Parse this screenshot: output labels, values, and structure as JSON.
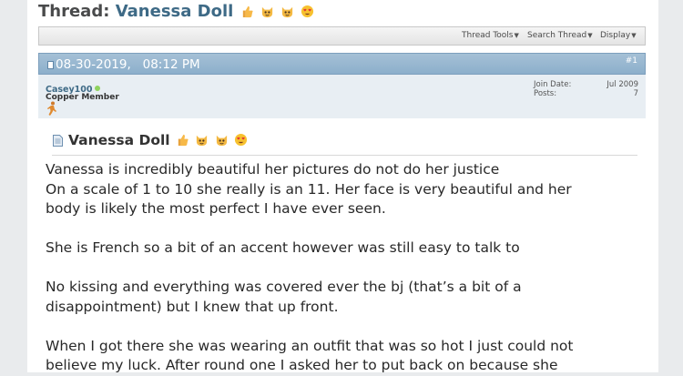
{
  "thread": {
    "prefix": "Thread:",
    "name": "Vanessa Doll",
    "emojis": [
      "thumbs-up-icon",
      "cat-face-icon",
      "cat-face-icon",
      "heart-eyes-icon"
    ]
  },
  "toolbar": {
    "thread_tools": "Thread Tools",
    "search_thread": "Search Thread",
    "display": "Display"
  },
  "post": {
    "date": "08-30-2019,",
    "time": "08:12 PM",
    "number": "#1",
    "author": {
      "username": "Casey100",
      "title": "Copper Member",
      "join_date_label": "Join Date:",
      "join_date": "Jul 2009",
      "posts_label": "Posts:",
      "posts": "7"
    },
    "title": "Vanessa Doll",
    "body": {
      "l1": "Vanessa is incredibly beautiful her pictures do not do her justice",
      "l2": "On a scale of 1 to 10 she really is an 11. Her face is very beautiful and her",
      "l3": "body is likely the most perfect I have ever seen.",
      "l4": "She is French so a bit of an accent however was still easy to talk to",
      "l5": "No kissing and everything was covered ever the bj (that’s a bit of a",
      "l6": "disappointment) but I knew that up front.",
      "l7": "When I got there she was wearing an outfit that was so hot I just could not",
      "l8": "believe my luck. After round one I asked her to put back on because she"
    }
  },
  "colors": {
    "header_blue": "#8cafcb",
    "link_blue": "#3e6a86",
    "online_green": "#8fd25e"
  }
}
